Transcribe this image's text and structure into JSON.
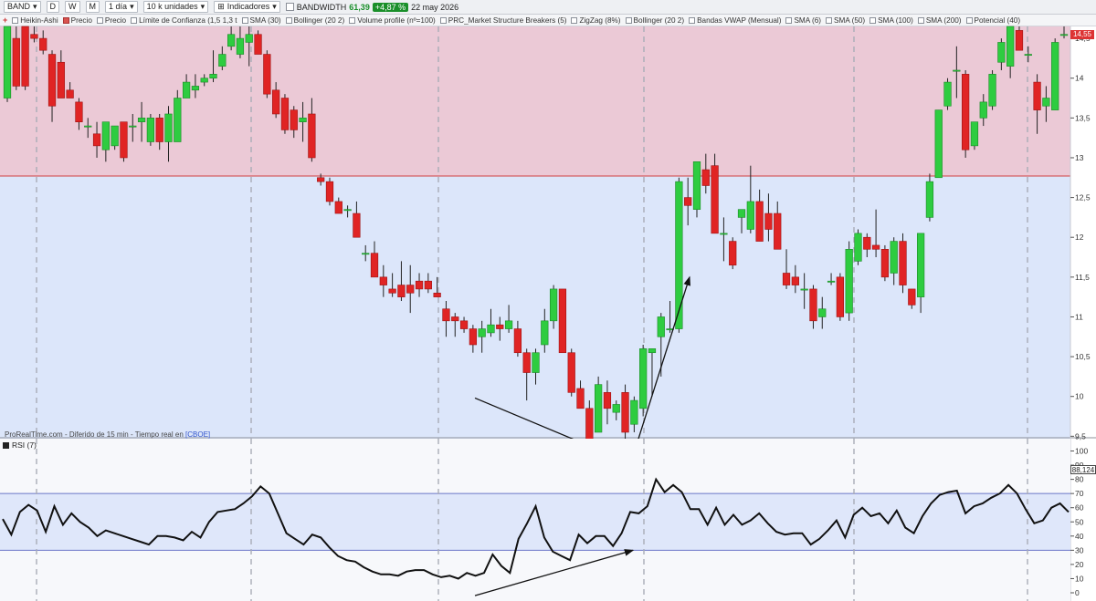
{
  "toolbar": {
    "ticker": "BAND",
    "periods": [
      "D",
      "W",
      "M"
    ],
    "interval": "1 día",
    "units": "10 k unidades",
    "indicators_label": "Indicadores",
    "indicator_name": "BANDWIDTH",
    "indicator_value": "61,39",
    "change": "+4,87 %",
    "date": "22 may 2026"
  },
  "legend": {
    "items": [
      "Heikin-Ashi",
      "Precio",
      "Precio",
      "Límite de Confianza (1,5 1,3 t",
      "SMA (30)",
      "Bollinger (20 2)",
      "Volume profile (nº=100)",
      "PRC_Market Structure Breakers (5)",
      "ZigZag (8%)",
      "Bollinger (20 2)",
      "Bandas VWAP  (Mensual)",
      "SMA (6)",
      "SMA (50)",
      "SMA (100)",
      "SMA (200)",
      "Potencial (40)"
    ]
  },
  "footer": {
    "source": "ProRealTime.com - Diferido de 15 min - Tiempo real en",
    "exchange": "[CBOE]"
  },
  "rsi": {
    "label": "RSI (7)",
    "current": "88,124"
  },
  "colors": {
    "up": "#2ecc40",
    "down": "#e02424",
    "resistance_zone": "#ebc9d6",
    "support_zone": "#dce6fa",
    "zone_line": "#d04040",
    "rsi_line": "#111111",
    "rsi_levels": "#6a76c8"
  },
  "chart_data": {
    "type": "candlestick",
    "price_axis": {
      "ticks": [
        "14,5",
        "14",
        "13,5",
        "13",
        "12,5",
        "12",
        "11,5",
        "11",
        "10,5",
        "10",
        "9,5"
      ],
      "ylim": [
        9.15,
        14.65
      ]
    },
    "zones": {
      "resistance_from": 12.77,
      "support_to": 9.4
    },
    "candles": [
      {
        "o": 13.75,
        "h": 14.65,
        "l": 13.7,
        "c": 14.65
      },
      {
        "o": 14.5,
        "h": 14.65,
        "l": 13.85,
        "c": 13.9
      },
      {
        "o": 14.65,
        "h": 14.65,
        "l": 13.85,
        "c": 13.9
      },
      {
        "o": 14.55,
        "h": 14.65,
        "l": 14.45,
        "c": 14.5
      },
      {
        "o": 14.5,
        "h": 14.6,
        "l": 14.3,
        "c": 14.35
      },
      {
        "o": 14.3,
        "h": 14.35,
        "l": 13.45,
        "c": 13.65
      },
      {
        "o": 14.2,
        "h": 14.35,
        "l": 13.75,
        "c": 13.75
      },
      {
        "o": 13.85,
        "h": 13.95,
        "l": 13.75,
        "c": 13.75
      },
      {
        "o": 13.7,
        "h": 13.75,
        "l": 13.35,
        "c": 13.45
      },
      {
        "o": 13.4,
        "h": 13.5,
        "l": 13.25,
        "c": 13.4
      },
      {
        "o": 13.3,
        "h": 13.45,
        "l": 13.0,
        "c": 13.15
      },
      {
        "o": 13.1,
        "h": 13.45,
        "l": 12.95,
        "c": 13.45
      },
      {
        "o": 13.15,
        "h": 13.4,
        "l": 13.1,
        "c": 13.4
      },
      {
        "o": 13.45,
        "h": 13.45,
        "l": 12.95,
        "c": 13.0
      },
      {
        "o": 13.4,
        "h": 13.55,
        "l": 13.2,
        "c": 13.4
      },
      {
        "o": 13.45,
        "h": 13.7,
        "l": 13.2,
        "c": 13.5
      },
      {
        "o": 13.2,
        "h": 13.55,
        "l": 13.15,
        "c": 13.5
      },
      {
        "o": 13.5,
        "h": 13.55,
        "l": 13.1,
        "c": 13.2
      },
      {
        "o": 13.2,
        "h": 13.65,
        "l": 12.95,
        "c": 13.55
      },
      {
        "o": 13.2,
        "h": 13.85,
        "l": 13.2,
        "c": 13.75
      },
      {
        "o": 13.75,
        "h": 14.05,
        "l": 13.75,
        "c": 13.95
      },
      {
        "o": 13.85,
        "h": 14.05,
        "l": 13.75,
        "c": 13.9
      },
      {
        "o": 13.95,
        "h": 14.05,
        "l": 13.9,
        "c": 14.0
      },
      {
        "o": 14.0,
        "h": 14.35,
        "l": 13.95,
        "c": 14.05
      },
      {
        "o": 14.15,
        "h": 14.4,
        "l": 14.1,
        "c": 14.3
      },
      {
        "o": 14.4,
        "h": 14.65,
        "l": 14.35,
        "c": 14.55
      },
      {
        "o": 14.3,
        "h": 14.65,
        "l": 14.25,
        "c": 14.5
      },
      {
        "o": 14.45,
        "h": 14.65,
        "l": 14.15,
        "c": 14.55
      },
      {
        "o": 14.55,
        "h": 14.6,
        "l": 14.3,
        "c": 14.3
      },
      {
        "o": 14.3,
        "h": 14.35,
        "l": 13.75,
        "c": 13.8
      },
      {
        "o": 13.85,
        "h": 13.95,
        "l": 13.5,
        "c": 13.55
      },
      {
        "o": 13.75,
        "h": 13.8,
        "l": 13.3,
        "c": 13.35
      },
      {
        "o": 13.6,
        "h": 13.65,
        "l": 13.25,
        "c": 13.35
      },
      {
        "o": 13.45,
        "h": 13.7,
        "l": 13.2,
        "c": 13.5
      },
      {
        "o": 13.55,
        "h": 13.75,
        "l": 12.95,
        "c": 13.0
      },
      {
        "o": 12.75,
        "h": 12.8,
        "l": 12.65,
        "c": 12.7
      },
      {
        "o": 12.7,
        "h": 12.75,
        "l": 12.4,
        "c": 12.45
      },
      {
        "o": 12.45,
        "h": 12.5,
        "l": 12.3,
        "c": 12.3
      },
      {
        "o": 12.35,
        "h": 12.4,
        "l": 12.25,
        "c": 12.35
      },
      {
        "o": 12.3,
        "h": 12.45,
        "l": 12.0,
        "c": 12.0
      },
      {
        "o": 11.8,
        "h": 11.9,
        "l": 11.7,
        "c": 11.8
      },
      {
        "o": 11.8,
        "h": 11.95,
        "l": 11.5,
        "c": 11.5
      },
      {
        "o": 11.5,
        "h": 11.65,
        "l": 11.25,
        "c": 11.4
      },
      {
        "o": 11.35,
        "h": 11.55,
        "l": 11.25,
        "c": 11.3
      },
      {
        "o": 11.4,
        "h": 11.7,
        "l": 11.2,
        "c": 11.25
      },
      {
        "o": 11.4,
        "h": 11.65,
        "l": 11.05,
        "c": 11.3
      },
      {
        "o": 11.45,
        "h": 11.55,
        "l": 11.25,
        "c": 11.35
      },
      {
        "o": 11.45,
        "h": 11.55,
        "l": 11.3,
        "c": 11.35
      },
      {
        "o": 11.3,
        "h": 11.5,
        "l": 11.25,
        "c": 11.25
      },
      {
        "o": 11.1,
        "h": 11.2,
        "l": 10.75,
        "c": 10.95
      },
      {
        "o": 11.0,
        "h": 11.05,
        "l": 10.75,
        "c": 10.95
      },
      {
        "o": 10.95,
        "h": 11.0,
        "l": 10.8,
        "c": 10.85
      },
      {
        "o": 10.85,
        "h": 10.9,
        "l": 10.55,
        "c": 10.65
      },
      {
        "o": 10.75,
        "h": 10.95,
        "l": 10.55,
        "c": 10.85
      },
      {
        "o": 10.8,
        "h": 11.1,
        "l": 10.75,
        "c": 10.9
      },
      {
        "o": 10.9,
        "h": 11.0,
        "l": 10.7,
        "c": 10.85
      },
      {
        "o": 10.85,
        "h": 11.15,
        "l": 10.8,
        "c": 10.95
      },
      {
        "o": 10.85,
        "h": 10.95,
        "l": 10.5,
        "c": 10.55
      },
      {
        "o": 10.55,
        "h": 10.6,
        "l": 9.95,
        "c": 10.3
      },
      {
        "o": 10.3,
        "h": 10.6,
        "l": 10.15,
        "c": 10.55
      },
      {
        "o": 10.65,
        "h": 11.1,
        "l": 10.55,
        "c": 10.95
      },
      {
        "o": 10.95,
        "h": 11.4,
        "l": 10.85,
        "c": 11.35
      },
      {
        "o": 11.35,
        "h": 11.35,
        "l": 10.55,
        "c": 10.55
      },
      {
        "o": 10.55,
        "h": 10.6,
        "l": 10.0,
        "c": 10.05
      },
      {
        "o": 10.1,
        "h": 10.2,
        "l": 9.85,
        "c": 9.85
      },
      {
        "o": 9.85,
        "h": 9.95,
        "l": 9.4,
        "c": 9.45
      },
      {
        "o": 9.55,
        "h": 10.25,
        "l": 9.55,
        "c": 10.15
      },
      {
        "o": 10.05,
        "h": 10.2,
        "l": 9.65,
        "c": 9.85
      },
      {
        "o": 9.8,
        "h": 9.95,
        "l": 9.7,
        "c": 9.9
      },
      {
        "o": 10.05,
        "h": 10.15,
        "l": 9.3,
        "c": 9.55
      },
      {
        "o": 9.65,
        "h": 10.0,
        "l": 9.55,
        "c": 9.95
      },
      {
        "o": 9.85,
        "h": 10.65,
        "l": 9.75,
        "c": 10.6
      },
      {
        "o": 10.55,
        "h": 10.6,
        "l": 10.0,
        "c": 10.6
      },
      {
        "o": 10.75,
        "h": 11.05,
        "l": 10.25,
        "c": 11.0
      },
      {
        "o": 10.85,
        "h": 11.2,
        "l": 10.8,
        "c": 10.85
      },
      {
        "o": 10.85,
        "h": 12.75,
        "l": 10.8,
        "c": 12.7
      },
      {
        "o": 12.5,
        "h": 12.75,
        "l": 12.15,
        "c": 12.4
      },
      {
        "o": 12.35,
        "h": 12.95,
        "l": 12.25,
        "c": 12.95
      },
      {
        "o": 12.85,
        "h": 13.05,
        "l": 12.55,
        "c": 12.65
      },
      {
        "o": 12.9,
        "h": 13.05,
        "l": 12.05,
        "c": 12.05
      },
      {
        "o": 12.05,
        "h": 12.25,
        "l": 11.7,
        "c": 12.05
      },
      {
        "o": 11.95,
        "h": 12.0,
        "l": 11.6,
        "c": 11.65
      },
      {
        "o": 12.25,
        "h": 12.35,
        "l": 12.05,
        "c": 12.35
      },
      {
        "o": 12.1,
        "h": 12.9,
        "l": 12.05,
        "c": 12.45
      },
      {
        "o": 12.45,
        "h": 12.6,
        "l": 11.95,
        "c": 11.95
      },
      {
        "o": 12.3,
        "h": 12.55,
        "l": 11.95,
        "c": 12.1
      },
      {
        "o": 12.3,
        "h": 12.45,
        "l": 11.85,
        "c": 11.85
      },
      {
        "o": 11.55,
        "h": 11.85,
        "l": 11.35,
        "c": 11.4
      },
      {
        "o": 11.5,
        "h": 11.65,
        "l": 11.3,
        "c": 11.4
      },
      {
        "o": 11.35,
        "h": 11.55,
        "l": 11.1,
        "c": 11.35
      },
      {
        "o": 11.35,
        "h": 11.4,
        "l": 10.85,
        "c": 10.95
      },
      {
        "o": 11.0,
        "h": 11.25,
        "l": 10.85,
        "c": 11.1
      },
      {
        "o": 11.45,
        "h": 11.55,
        "l": 11.4,
        "c": 11.45
      },
      {
        "o": 11.5,
        "h": 11.55,
        "l": 10.95,
        "c": 11.0
      },
      {
        "o": 11.05,
        "h": 11.95,
        "l": 10.95,
        "c": 11.85
      },
      {
        "o": 11.7,
        "h": 12.1,
        "l": 11.65,
        "c": 12.05
      },
      {
        "o": 12.0,
        "h": 12.05,
        "l": 11.75,
        "c": 11.85
      },
      {
        "o": 11.9,
        "h": 12.35,
        "l": 11.75,
        "c": 11.85
      },
      {
        "o": 11.85,
        "h": 11.9,
        "l": 11.45,
        "c": 11.5
      },
      {
        "o": 11.55,
        "h": 12.0,
        "l": 11.4,
        "c": 11.95
      },
      {
        "o": 11.95,
        "h": 12.05,
        "l": 11.3,
        "c": 11.4
      },
      {
        "o": 11.35,
        "h": 11.35,
        "l": 11.1,
        "c": 11.15
      },
      {
        "o": 11.25,
        "h": 12.05,
        "l": 11.05,
        "c": 12.05
      },
      {
        "o": 12.25,
        "h": 12.8,
        "l": 12.2,
        "c": 12.7
      },
      {
        "o": 12.75,
        "h": 13.6,
        "l": 12.75,
        "c": 13.6
      },
      {
        "o": 13.65,
        "h": 14.0,
        "l": 13.6,
        "c": 13.95
      },
      {
        "o": 14.1,
        "h": 14.4,
        "l": 13.75,
        "c": 14.1
      },
      {
        "o": 14.05,
        "h": 14.1,
        "l": 13.0,
        "c": 13.1
      },
      {
        "o": 13.15,
        "h": 13.45,
        "l": 13.1,
        "c": 13.45
      },
      {
        "o": 13.5,
        "h": 13.8,
        "l": 13.4,
        "c": 13.7
      },
      {
        "o": 13.65,
        "h": 14.1,
        "l": 13.6,
        "c": 14.05
      },
      {
        "o": 14.2,
        "h": 14.5,
        "l": 14.1,
        "c": 14.45
      },
      {
        "o": 14.15,
        "h": 14.65,
        "l": 14.0,
        "c": 14.65
      },
      {
        "o": 14.6,
        "h": 14.65,
        "l": 14.35,
        "c": 14.35
      },
      {
        "o": 14.3,
        "h": 14.4,
        "l": 14.2,
        "c": 14.3
      },
      {
        "o": 13.95,
        "h": 14.05,
        "l": 13.3,
        "c": 13.6
      },
      {
        "o": 13.65,
        "h": 13.9,
        "l": 13.45,
        "c": 13.75
      },
      {
        "o": 13.6,
        "h": 14.5,
        "l": 13.6,
        "c": 14.45
      },
      {
        "o": 14.55,
        "h": 14.65,
        "l": 14.5,
        "c": 14.55
      }
    ],
    "rsi_axis": {
      "ticks": [
        "100",
        "90",
        "80",
        "70",
        "60",
        "50",
        "40",
        "30",
        "20",
        "10",
        "0"
      ],
      "ylim": [
        0,
        100
      ],
      "levels": [
        70,
        30
      ]
    },
    "rsi_values": [
      52,
      41,
      57,
      62,
      58,
      43,
      61,
      48,
      56,
      50,
      46,
      40,
      44,
      42,
      40,
      38,
      36,
      34,
      40,
      40,
      39,
      37,
      43,
      39,
      50,
      57,
      58,
      59,
      63,
      68,
      75,
      70,
      56,
      42,
      38,
      34,
      41,
      39,
      32,
      26,
      23,
      22,
      18,
      15,
      13,
      13,
      12,
      15,
      16,
      16,
      13,
      11,
      12,
      10,
      14,
      12,
      14,
      27,
      19,
      14,
      38,
      49,
      61,
      39,
      29,
      26,
      23,
      41,
      35,
      40,
      40,
      33,
      42,
      57,
      56,
      61,
      80,
      71,
      76,
      71,
      59,
      59,
      48,
      60,
      48,
      55,
      48,
      51,
      56,
      49,
      43,
      41,
      42,
      42,
      34,
      38,
      44,
      51,
      39,
      55,
      60,
      54,
      56,
      49,
      58,
      46,
      42,
      54,
      63,
      69,
      71,
      72,
      56,
      61,
      63,
      67,
      70,
      76,
      70,
      59,
      49,
      51,
      60,
      63,
      57
    ]
  }
}
